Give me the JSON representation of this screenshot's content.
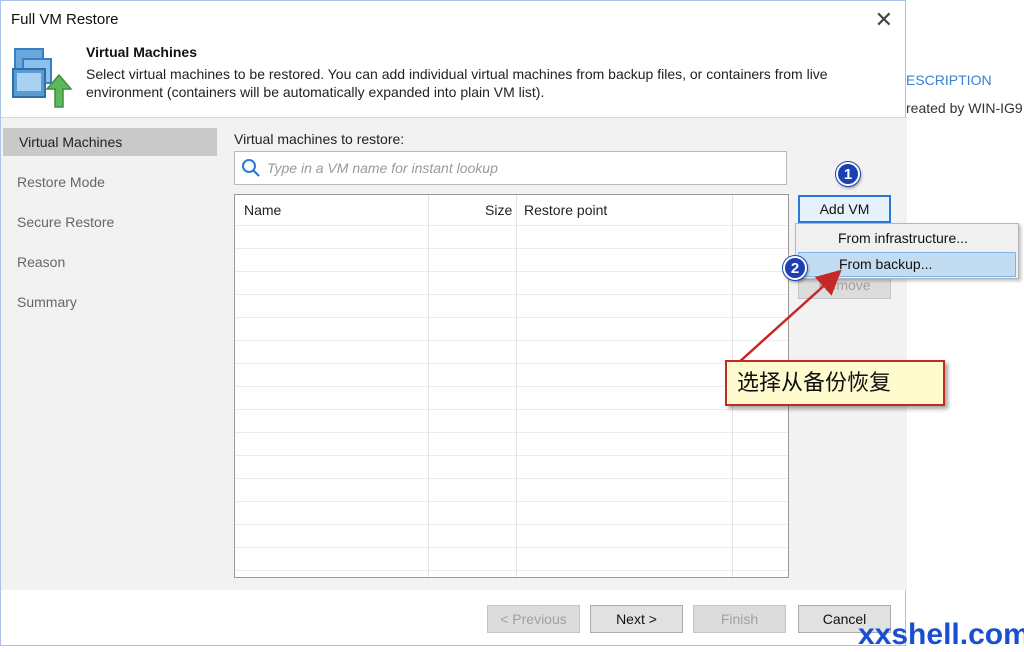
{
  "background_window": {
    "description_header": "ESCRIPTION",
    "created_text": "reated by WIN-IG9"
  },
  "dialog": {
    "title": "Full VM Restore",
    "close_glyph": "✕",
    "header": {
      "icon": "vm-restore-icon",
      "title": "Virtual Machines",
      "description": "Select virtual machines to be restored. You can add individual virtual machines from backup files, or containers from live environment (containers will be automatically expanded into plain VM list)."
    },
    "nav": [
      {
        "label": "Virtual Machines",
        "active": true
      },
      {
        "label": "Restore Mode",
        "active": false
      },
      {
        "label": "Secure Restore",
        "active": false
      },
      {
        "label": "Reason",
        "active": false
      },
      {
        "label": "Summary",
        "active": false
      }
    ],
    "main": {
      "section_label": "Virtual machines to restore:",
      "search": {
        "placeholder": "Type in a VM name for instant lookup",
        "value": ""
      },
      "table": {
        "columns": [
          "Name",
          "Size",
          "Restore point"
        ],
        "rows": []
      }
    },
    "buttons": {
      "add_vm": "Add VM",
      "remove": "Remove"
    },
    "add_vm_menu": {
      "items": [
        "From infrastructure...",
        "From backup..."
      ],
      "selected": "From backup..."
    },
    "footer": {
      "previous": "< Previous",
      "next": "Next >",
      "finish": "Finish",
      "cancel": "Cancel"
    }
  },
  "annotations": {
    "badge_1": "1",
    "badge_2": "2",
    "callout": "选择从备份恢复",
    "callout_border_color": "#c62828",
    "badge_color": "#1c3fb2"
  },
  "watermark": "xxshell.com"
}
